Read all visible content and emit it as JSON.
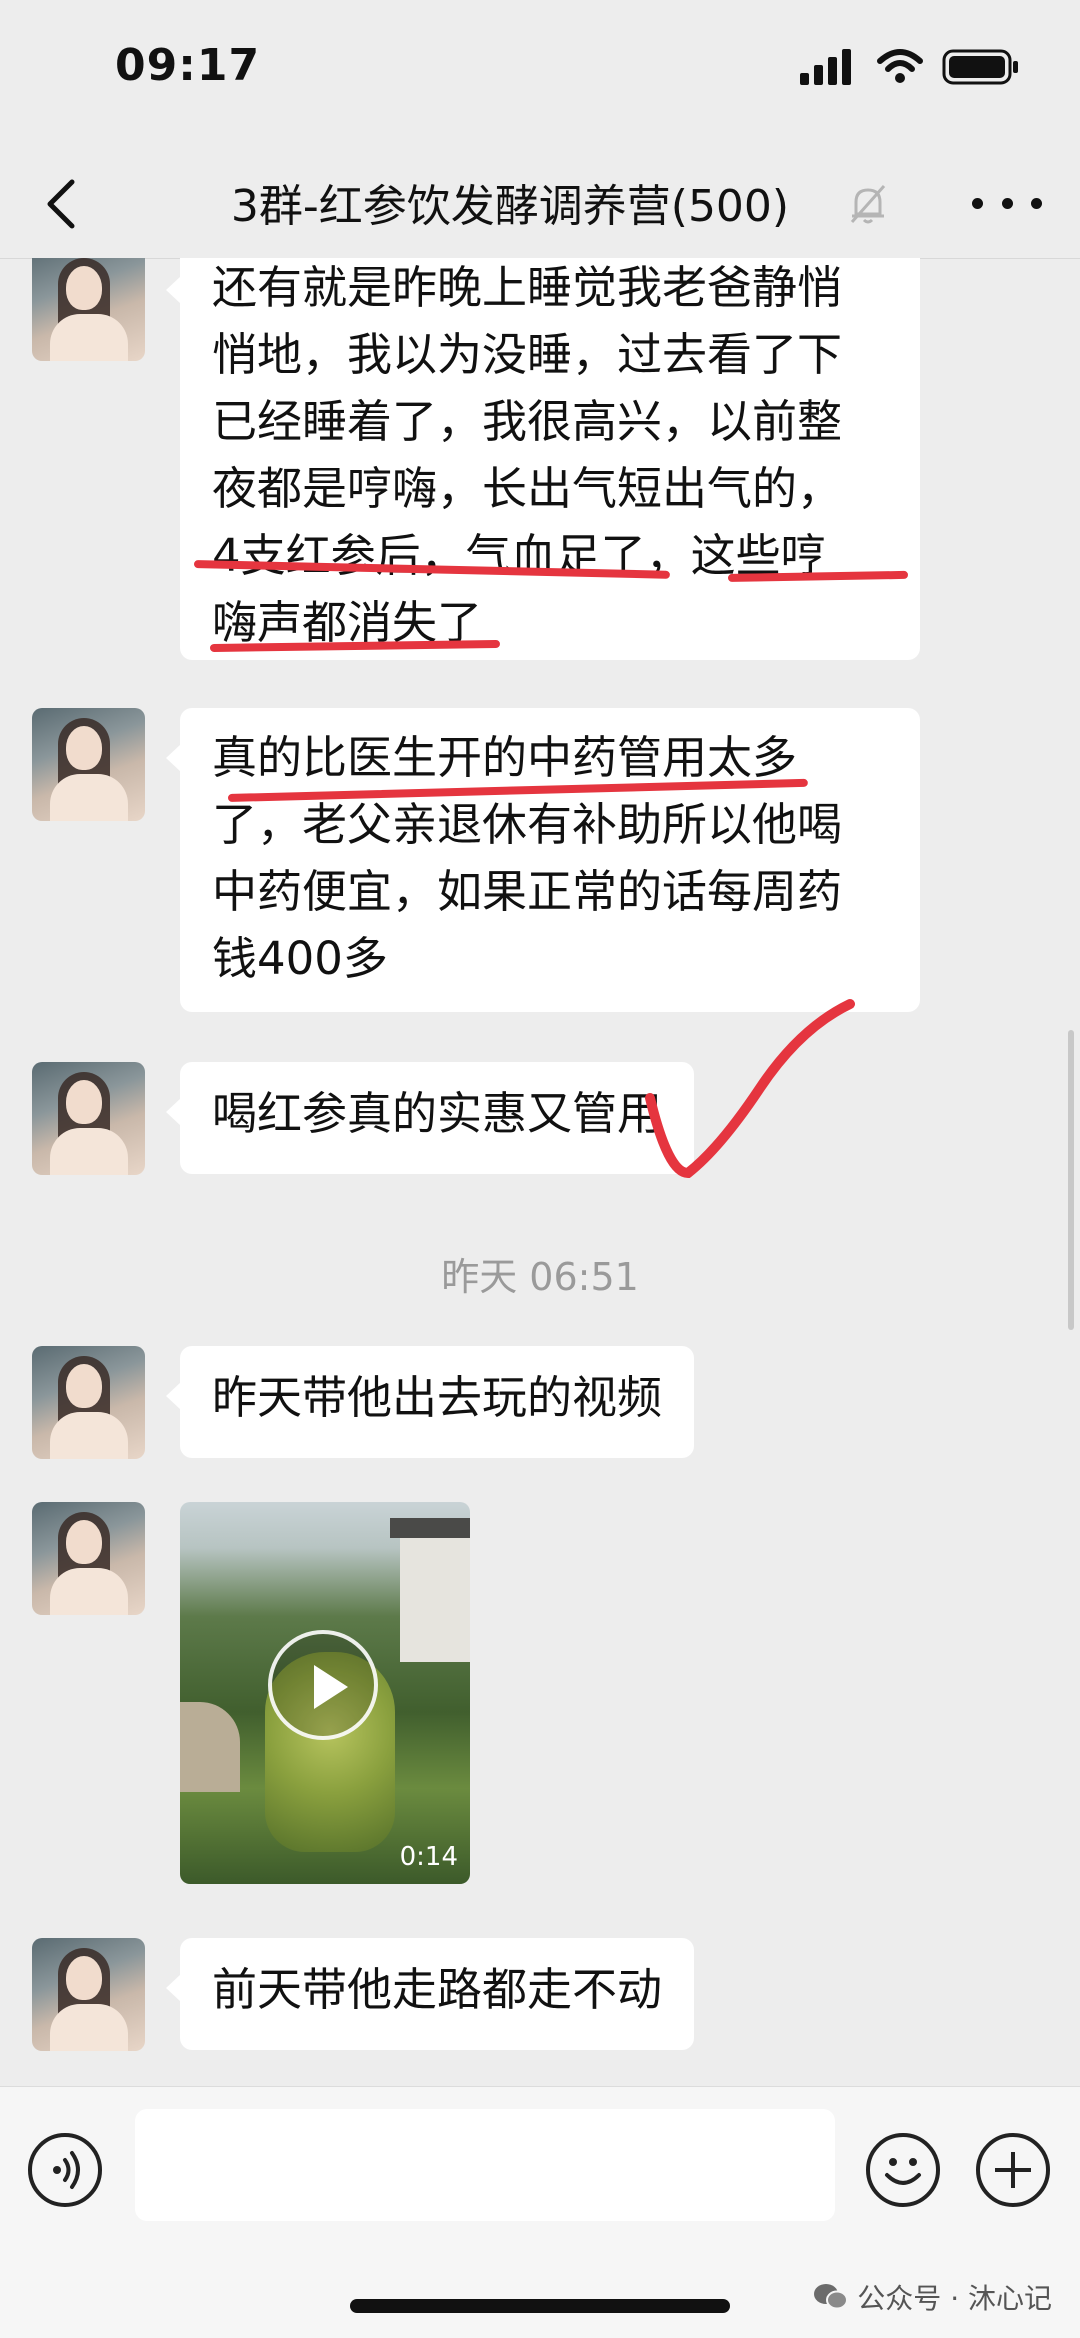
{
  "status_bar": {
    "time": "09:17"
  },
  "header": {
    "title": "3群-红参饮发酵调养营(500)"
  },
  "messages": {
    "m1": {
      "lines": [
        "还有就是昨晚上睡觉我老爸静悄",
        "悄地，我以为没睡，过去看了下",
        "已经睡着了，我很高兴，以前整",
        "夜都是哼嗨，长出气短出气的，",
        "4支红参后，气血足了，这些哼",
        "嗨声都消失了"
      ]
    },
    "m2": {
      "lines": [
        "真的比医生开的中药管用太多",
        "了，老父亲退休有补助所以他喝",
        "中药便宜，如果正常的话每周药",
        "钱400多"
      ]
    },
    "m3": {
      "text": "喝红参真的实惠又管用"
    },
    "timestamp": "昨天 06:51",
    "m4": {
      "text": "昨天带他出去玩的视频"
    },
    "m5": {
      "video_duration": "0:14"
    },
    "m6": {
      "text": "前天带他走路都走不动"
    }
  },
  "watermark": {
    "text": "公众号 · 沐心记"
  },
  "colors": {
    "annotation_red": "#e5353f",
    "background": "#ededed",
    "bubble": "#ffffff"
  }
}
